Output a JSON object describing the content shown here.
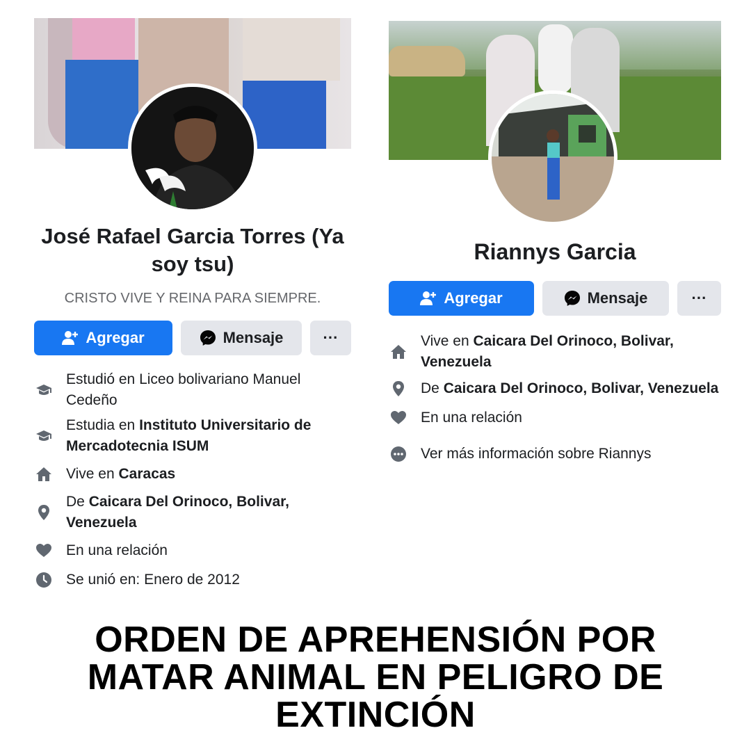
{
  "profiles": [
    {
      "name": "José Rafael Garcia Torres (Ya soy tsu)",
      "bio": "CRISTO VIVE Y REINA PARA SIEMPRE.",
      "actions": {
        "add": "Agregar",
        "message": "Mensaje",
        "more": "···"
      },
      "info": [
        {
          "icon": "graduation-cap-icon",
          "text": "Estudió en Liceo bolivariano Manuel Cedeño"
        },
        {
          "icon": "graduation-cap-icon",
          "prefix": "Estudia en ",
          "strong": "Instituto Universitario de Mercadotecnia ISUM"
        },
        {
          "icon": "home-icon",
          "prefix": "Vive en ",
          "strong": "Caracas"
        },
        {
          "icon": "location-pin-icon",
          "prefix": "De ",
          "strong": "Caicara Del Orinoco, Bolivar, Venezuela"
        },
        {
          "icon": "heart-icon",
          "text": "En una relación"
        },
        {
          "icon": "clock-icon",
          "text": "Se unió en: Enero de 2012"
        }
      ]
    },
    {
      "name": "Riannys Garcia",
      "actions": {
        "add": "Agregar",
        "message": "Mensaje",
        "more": "···"
      },
      "info": [
        {
          "icon": "home-icon",
          "prefix": "Vive en ",
          "strong": "Caicara Del Orinoco, Bolivar, Venezuela"
        },
        {
          "icon": "location-pin-icon",
          "prefix": "De ",
          "strong": "Caicara Del Orinoco, Bolivar, Venezuela"
        },
        {
          "icon": "heart-icon",
          "text": "En una relación"
        },
        {
          "icon": "more-circle-icon",
          "text": "Ver más información sobre Riannys"
        }
      ]
    }
  ],
  "headline": "ORDEN DE APREHENSIÓN POR MATAR ANIMAL EN PELIGRO DE EXTINCIÓN",
  "colors": {
    "primary_button": "#1877f2",
    "secondary_button": "#e4e6eb",
    "muted_text": "#65676b",
    "icon": "#606770"
  }
}
